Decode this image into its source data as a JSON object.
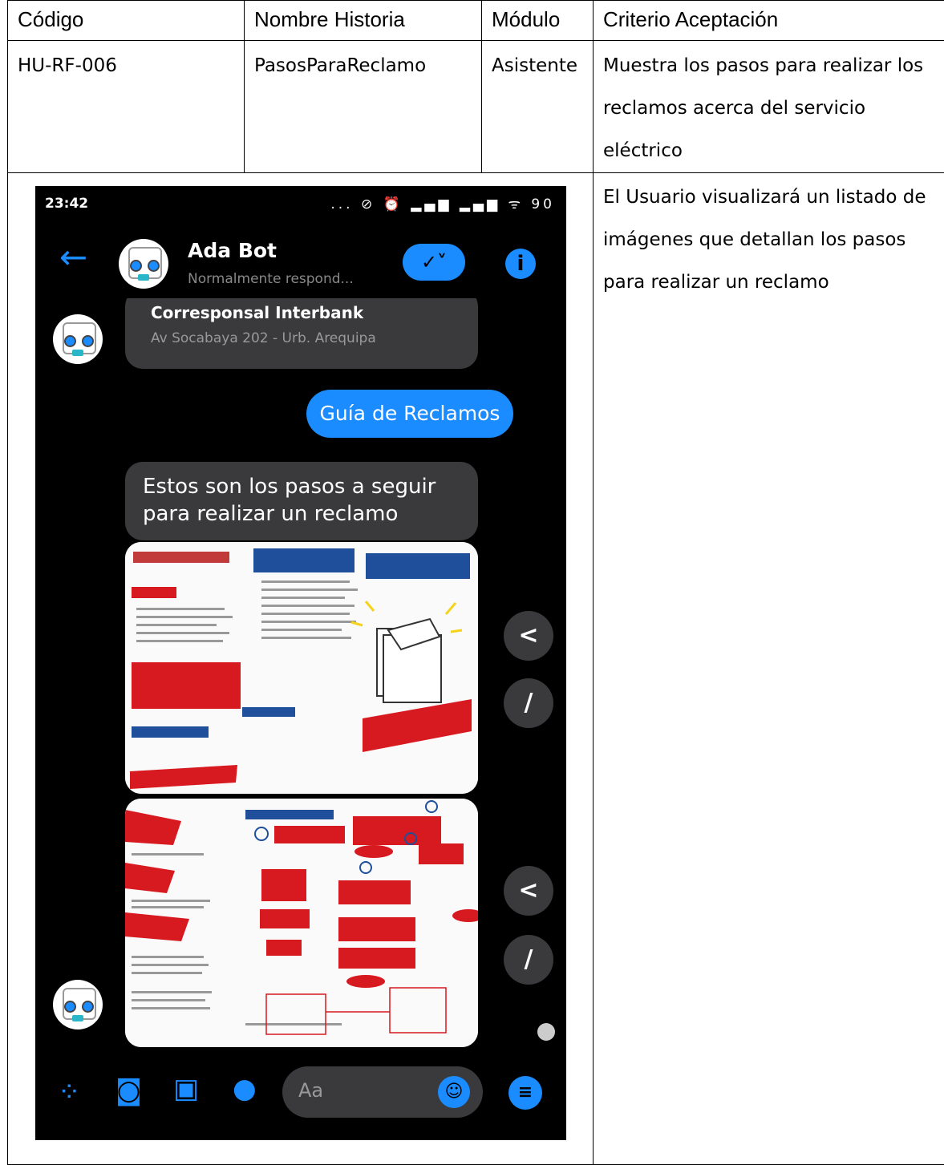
{
  "table": {
    "headers": [
      "Código",
      "Nombre Historia",
      "Módulo",
      "Criterio Aceptación"
    ],
    "row": {
      "codigo": "HU-RF-006",
      "nombre": "PasosParaReclamo",
      "modulo": "Asistente",
      "criterio_lines": [
        "Muestra los pasos para realizar los",
        "reclamos acerca del servicio",
        "eléctrico"
      ]
    },
    "criterio2_lines": [
      "El Usuario visualizará un listado de",
      "imágenes que detallan los pasos",
      "para realizar un reclamo"
    ]
  },
  "phone": {
    "time": "23:42",
    "status_icons": "... ⊘ ⏰ ▂▄▆ ▂▄▆ ᯤ 90",
    "bot_name": "Ada Bot",
    "bot_status": "Normalmente respond...",
    "card_title": "Corresponsal Interbank",
    "card_subtitle": "Av Socabaya 202 - Urb. Arequipa",
    "user_message": "Guía de Reclamos",
    "bot_message": "Estos son los pasos a seguir para realizar un reclamo",
    "input_placeholder": "Aa",
    "colors": {
      "accent": "#1a8cff",
      "bubble": "#3a3a3c",
      "background": "#000000",
      "infographic_red": "#d71920",
      "infographic_blue": "#1f4e9a"
    },
    "icons": [
      "back-arrow-icon",
      "check-icon",
      "info-icon",
      "share-icon",
      "edit-icon",
      "apps-icon",
      "camera-icon",
      "gallery-icon",
      "mic-icon",
      "emoji-icon",
      "menu-icon"
    ]
  }
}
